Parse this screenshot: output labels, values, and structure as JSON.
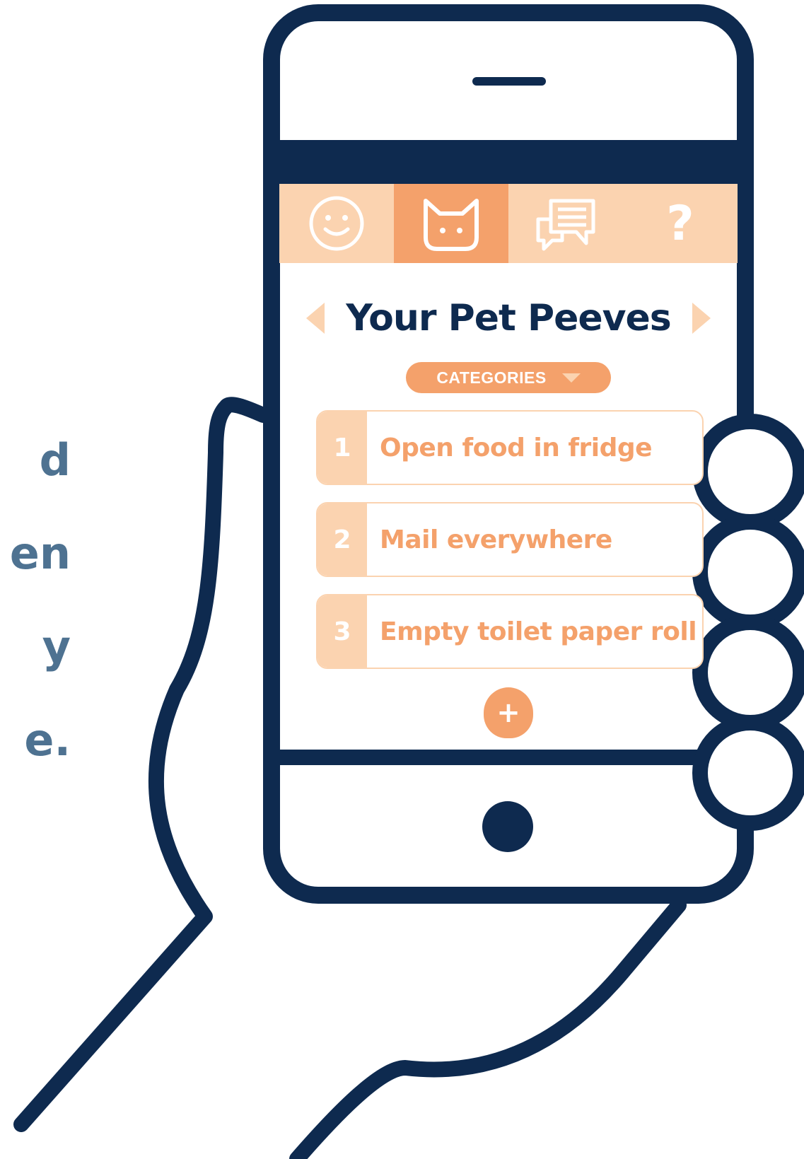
{
  "side_text": {
    "lines": [
      "d",
      "en",
      "y",
      "e."
    ]
  },
  "tabs": [
    {
      "icon": "smiley-icon",
      "active": false
    },
    {
      "icon": "cat-icon",
      "active": true
    },
    {
      "icon": "chat-bubbles-icon",
      "active": false
    },
    {
      "icon": "question-icon",
      "active": false,
      "glyph": "?"
    }
  ],
  "header": {
    "title": "Your Pet Peeves"
  },
  "categories": {
    "label": "CATEGORIES"
  },
  "peeves": [
    {
      "number": "1",
      "text": "Open food in fridge"
    },
    {
      "number": "2",
      "text": "Mail everywhere"
    },
    {
      "number": "3",
      "text": "Empty toilet paper roll"
    }
  ],
  "add_button": {
    "glyph": "+"
  },
  "colors": {
    "navy": "#0e2a4f",
    "accent": "#f4a16b",
    "accent_light": "#fbd3b0",
    "side_text": "#4e7291"
  }
}
